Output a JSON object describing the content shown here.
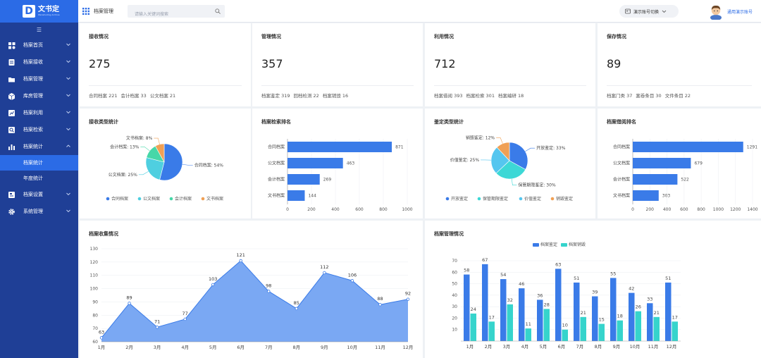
{
  "app": {
    "logo_mark": "D",
    "name": "文书定",
    "subtitle": "Wenshuding Archive"
  },
  "topbar": {
    "title": "档案管理",
    "search_placeholder": "请输入关键词搜索",
    "switch_label": "演示账号切换",
    "user_name": "通用演示账号"
  },
  "sidebar": {
    "items": [
      {
        "label": "档案首页",
        "icon": "home-icon"
      },
      {
        "label": "档案接收",
        "icon": "inbox-icon"
      },
      {
        "label": "档案管理",
        "icon": "folder-icon"
      },
      {
        "label": "库房管理",
        "icon": "warehouse-icon"
      },
      {
        "label": "档案利用",
        "icon": "usage-icon"
      },
      {
        "label": "档案检索",
        "icon": "search-doc-icon"
      },
      {
        "label": "档案统计",
        "icon": "bar-chart-icon"
      },
      {
        "label": "档案设置",
        "icon": "settings-doc-icon"
      },
      {
        "label": "系统管理",
        "icon": "gear-icon"
      }
    ],
    "sub_items": [
      "档案统计",
      "年度统计"
    ]
  },
  "stats": [
    {
      "title": "接收情况",
      "value": "275",
      "details": [
        "合同档案 221",
        "会计档案 33",
        "公文档案 21"
      ]
    },
    {
      "title": "管理情况",
      "value": "357",
      "details": [
        "档案鉴定 319",
        "回档检测 22",
        "档案销毁 16"
      ]
    },
    {
      "title": "利用情况",
      "value": "712",
      "details": [
        "档案借阅 393",
        "档案检索 301",
        "档案编研 18"
      ]
    },
    {
      "title": "保存情况",
      "value": "89",
      "details": [
        "档案门类 37",
        "案卷条目 30",
        "文件条目 22"
      ]
    }
  ],
  "chart_data": [
    {
      "type": "pie",
      "title": "接收类型统计",
      "labels": [
        "合同档案",
        "公文档案",
        "会计档案",
        "文书档案"
      ],
      "values": [
        54,
        25,
        13,
        8
      ],
      "colors": [
        "#3a7be8",
        "#4fcfe0",
        "#46d7a8",
        "#f0a055"
      ],
      "slice_labels": [
        "合同档案: 54%",
        "公文档案: 25%",
        "会计档案: 13%",
        "文书档案: 8%"
      ]
    },
    {
      "type": "bar",
      "title": "档案检索排名",
      "categories": [
        "合同档案",
        "公文档案",
        "会计档案",
        "文书档案"
      ],
      "values": [
        871,
        463,
        269,
        144
      ],
      "xlim": [
        0,
        1000
      ],
      "ticks": [
        0,
        200,
        400,
        600,
        800,
        1000
      ]
    },
    {
      "type": "pie",
      "title": "鉴定类型统计",
      "labels": [
        "开放鉴定",
        "保管期限鉴定",
        "价值鉴定",
        "销毁鉴定"
      ],
      "values": [
        33,
        30,
        25,
        12
      ],
      "colors": [
        "#3a7be8",
        "#3dd8d6",
        "#55c6ef",
        "#f0a055"
      ],
      "slice_labels": [
        "开放鉴定: 33%",
        "保管期限鉴定: 30%",
        "价值鉴定: 25%",
        "销毁鉴定: 12%"
      ]
    },
    {
      "type": "bar",
      "title": "档案借阅排名",
      "categories": [
        "合同档案",
        "公文档案",
        "会计档案",
        "文书档案"
      ],
      "values": [
        1291,
        679,
        522,
        303
      ],
      "xlim": [
        0,
        1400
      ],
      "ticks": [
        0,
        200,
        400,
        600,
        800,
        1000,
        1200,
        1400
      ]
    },
    {
      "type": "area",
      "title": "档案收集情况",
      "x": [
        "1月",
        "2月",
        "3月",
        "4月",
        "5月",
        "6月",
        "7月",
        "8月",
        "9月",
        "10月",
        "11月",
        "12月"
      ],
      "values": [
        63,
        89,
        71,
        77,
        103,
        121,
        98,
        85,
        112,
        106,
        88,
        92
      ],
      "ylim": [
        60,
        130
      ],
      "ticks": [
        60,
        70,
        80,
        90,
        100,
        110,
        120,
        130
      ]
    },
    {
      "type": "bar",
      "title": "档案管理情况",
      "x": [
        "1月",
        "2月",
        "3月",
        "4月",
        "5月",
        "6月",
        "7月",
        "8月",
        "9月",
        "10月",
        "11月",
        "12月"
      ],
      "series": [
        {
          "name": "档案鉴定",
          "color": "#3a7be8",
          "values": [
            58,
            67,
            54,
            46,
            36,
            63,
            51,
            39,
            55,
            42,
            33,
            51
          ]
        },
        {
          "name": "档案销毁",
          "color": "#36d4cc",
          "values": [
            24,
            17,
            32,
            11,
            28,
            10,
            21,
            15,
            18,
            26,
            21,
            17
          ]
        }
      ],
      "ylim": [
        0,
        70
      ],
      "ticks": [
        10,
        20,
        30,
        40,
        50,
        60,
        70
      ]
    }
  ]
}
